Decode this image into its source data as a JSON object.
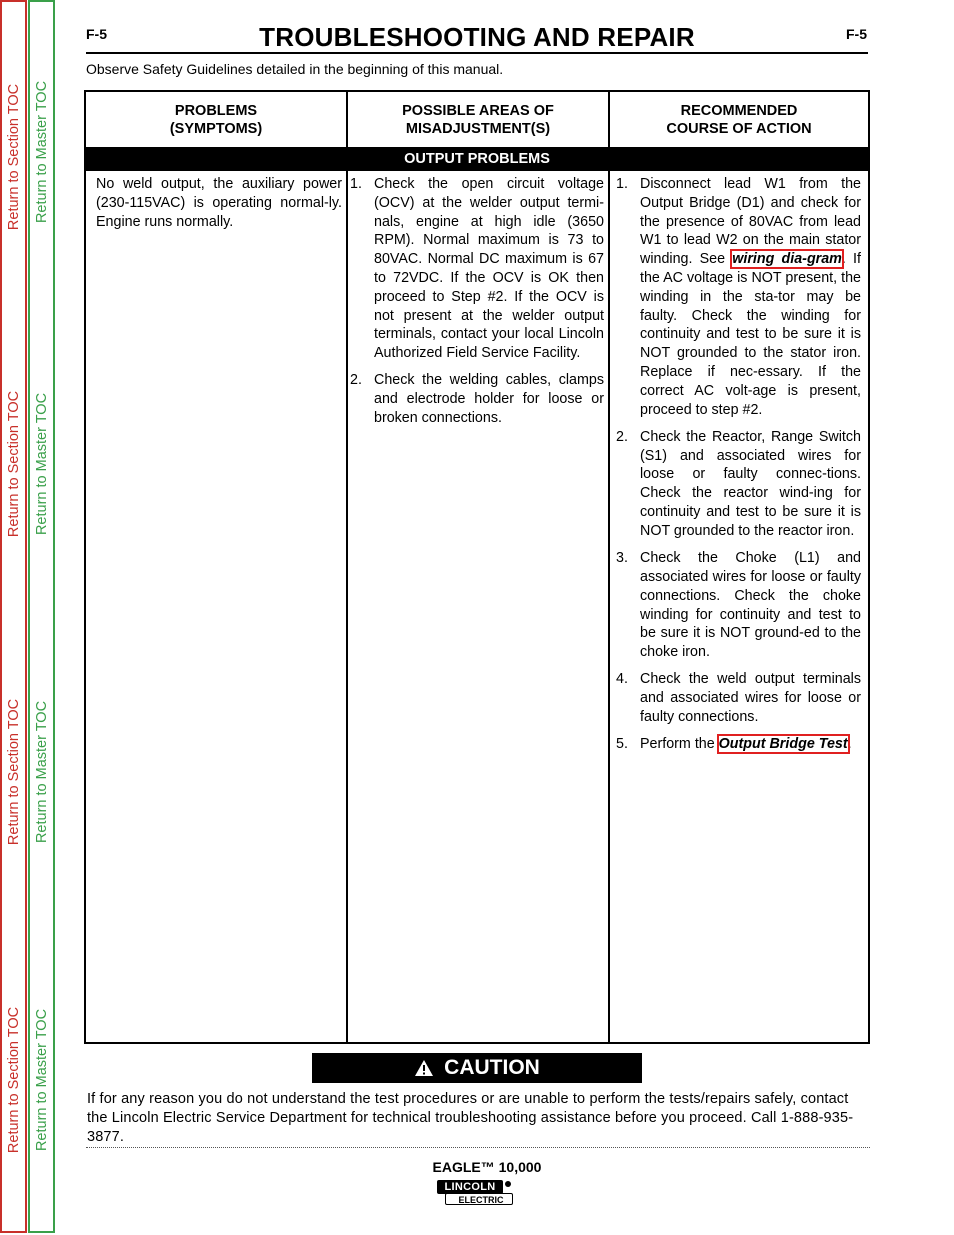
{
  "side_nav": {
    "section_label": "Return to Section TOC",
    "master_label": "Return to Master TOC",
    "colors": {
      "section": "#c8302a",
      "master": "#3aa04a"
    }
  },
  "header": {
    "page_left": "F-5",
    "page_right": "F-5",
    "title": "TROUBLESHOOTING AND REPAIR",
    "safety_note": "Observe Safety Guidelines detailed in the beginning of this manual."
  },
  "table": {
    "headers": [
      {
        "line1": "PROBLEMS",
        "line2": "(SYMPTOMS)"
      },
      {
        "line1": "POSSIBLE AREAS OF",
        "line2": "MISADJUSTMENT(S)"
      },
      {
        "line1": "RECOMMENDED",
        "line2": "COURSE OF ACTION"
      }
    ],
    "section_band": "OUTPUT PROBLEMS",
    "symptom": "No weld output, the auxiliary power (230-115VAC) is operating normal-ly.  Engine runs normally.",
    "misadjustments": [
      {
        "num": "1.",
        "text": "Check the open circuit voltage (OCV) at the welder output termi-nals, engine at high idle (3650 RPM).  Normal maximum is 73 to 80VAC.  Normal DC maximum is 67 to 72VDC.  If the OCV is OK then proceed to Step #2.  If the OCV is not present at the welder output terminals, contact your local Lincoln Authorized Field Service Facility."
      },
      {
        "num": "2.",
        "text": "Check the welding cables, clamps and electrode holder for loose or broken connections."
      }
    ],
    "actions": [
      {
        "num": "1.",
        "pre": "Disconnect lead W1 from the Output Bridge (D1) and check for the presence of 80VAC from lead W1 to lead W2 on the main stator winding.  See ",
        "link": "wiring dia-gram",
        "post": ".  If the AC voltage is NOT present, the winding in the sta-tor may be faulty.  Check the winding for continuity and test to be sure it is NOT grounded to the stator iron.  Replace if nec-essary.  If the correct AC volt-age is present, proceed to step #2."
      },
      {
        "num": "2.",
        "pre": "Check the Reactor, Range Switch (S1) and associated wires for loose or faulty connec-tions.  Check the reactor wind-ing for continuity and test to be sure it is NOT grounded to the reactor iron.",
        "link": null,
        "post": ""
      },
      {
        "num": "3.",
        "pre": "Check the Choke (L1) and associated wires for loose or faulty connections.  Check the choke winding for continuity and test to be sure it is NOT ground-ed to the choke iron.",
        "link": null,
        "post": ""
      },
      {
        "num": "4.",
        "pre": "Check the weld output terminals and associated wires for loose or faulty connections.",
        "link": null,
        "post": ""
      },
      {
        "num": "5.",
        "pre": "Perform the ",
        "link": "Output Bridge Test",
        "post": "."
      }
    ]
  },
  "caution": {
    "icon": "warning-triangle-icon",
    "label": "CAUTION",
    "text": "If for any reason you do not understand the test procedures or are unable to perform the tests/repairs safely, contact the Lincoln Electric Service Department for technical troubleshooting assistance before you proceed. Call 1-888-935-3877."
  },
  "footer": {
    "model": "EAGLE™ 10,000",
    "logo_top": "LINCOLN",
    "logo_bottom": "ELECTRIC"
  }
}
